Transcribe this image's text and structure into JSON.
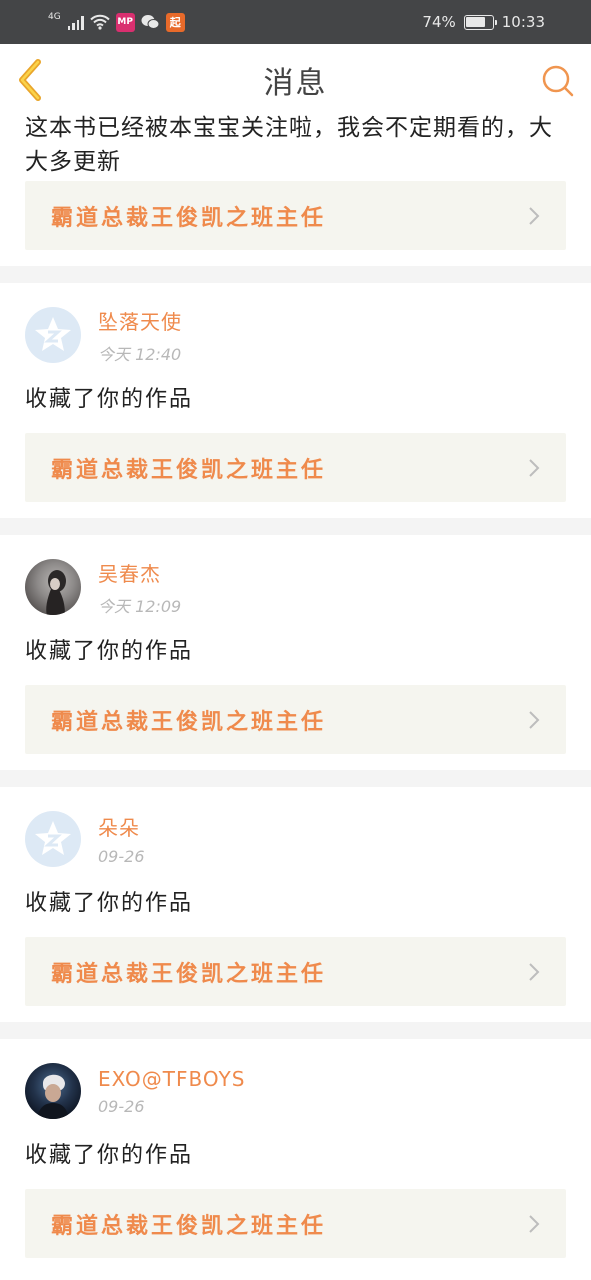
{
  "status_bar": {
    "network": "4G",
    "battery": "74%",
    "battery_level": 0.74,
    "time": "10:33",
    "apps": [
      "MP",
      "wechat",
      "QD"
    ]
  },
  "header": {
    "title": "消息"
  },
  "top_message": {
    "comment": "这本书已经被本宝宝关注啦，我会不定期看的，大大多更新",
    "book_title": "霸道总裁王俊凯之班主任"
  },
  "messages": [
    {
      "name": "坠落天使",
      "time": "今天 12:40",
      "text": "收藏了你的作品",
      "book_title": "霸道总裁王俊凯之班主任",
      "avatar": "default"
    },
    {
      "name": "吴春杰",
      "time": "今天 12:09",
      "text": "收藏了你的作品",
      "book_title": "霸道总裁王俊凯之班主任",
      "avatar": "photo"
    },
    {
      "name": "朵朵",
      "time": "09-26",
      "text": "收藏了你的作品",
      "book_title": "霸道总裁王俊凯之班主任",
      "avatar": "default"
    },
    {
      "name": "EXO@TFBOYS",
      "time": "09-26",
      "text": "收藏了你的作品",
      "book_title": "霸道总裁王俊凯之班主任",
      "avatar": "photo"
    }
  ],
  "colors": {
    "accent": "#ef8a4c",
    "link_bg": "#f5f5ef",
    "status_bg": "#444547"
  }
}
